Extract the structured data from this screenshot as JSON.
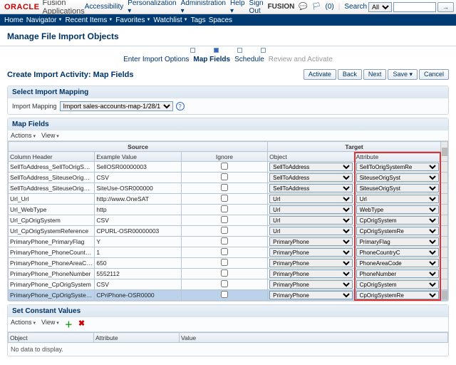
{
  "brand": {
    "oracle": "ORACLE",
    "product": "Fusion Applications"
  },
  "topnav": {
    "accessibility": "Accessibility",
    "personalization": "Personalization ▾",
    "administration": "Administration ▾",
    "help": "Help ▾",
    "signout": "Sign Out",
    "user": "FUSION",
    "flag": "🏳",
    "count": "(0)",
    "searchLabel": "Search",
    "searchScope": "All",
    "go": "→"
  },
  "menurow": {
    "home": "Home",
    "navigator": "Navigator",
    "recent": "Recent Items",
    "favorites": "Favorites",
    "watchlist": "Watchlist",
    "tags": "Tags",
    "spaces": "Spaces"
  },
  "pageTitle": "Manage File Import Objects",
  "wizard": {
    "step1": "Enter Import Options",
    "step2": "Map Fields",
    "step3": "Schedule",
    "step4": "Review and Activate"
  },
  "subtitle": "Create Import Activity: Map Fields",
  "actions": {
    "activate": "Activate",
    "back": "Back",
    "next": "Next",
    "save": "Save ▾",
    "cancel": "Cancel"
  },
  "mapping": {
    "title": "Select Import Mapping",
    "label": "Import Mapping",
    "value": "Import sales-accounts-map-1/28/1"
  },
  "mapfields": {
    "title": "Map Fields",
    "actions": "Actions",
    "view": "View",
    "groupSource": "Source",
    "groupTarget": "Target",
    "colHeader": "Column Header",
    "colExample": "Example Value",
    "colIgnore": "Ignore",
    "colObject": "Object",
    "colAttr": "Attribute",
    "rows": [
      {
        "h": "SellToAddress_SellToOrigSystemReference",
        "ex": "SellOSR00000003",
        "obj": "SellToAddress",
        "attr": "SellToOrigSystemRe"
      },
      {
        "h": "SellToAddress_SiteuseOrigSystem",
        "ex": "CSV",
        "obj": "SellToAddress",
        "attr": "SiteuseOrigSyst"
      },
      {
        "h": "SellToAddress_SiteuseOrigSystemRef",
        "ex": "SiteUse-OSR000000",
        "obj": "SellToAddress",
        "attr": "SiteuseOrigSyst"
      },
      {
        "h": "Url_Url",
        "ex": "http://www.OneSAT",
        "obj": "Url",
        "attr": "Url"
      },
      {
        "h": "Url_WebType",
        "ex": "http",
        "obj": "Url",
        "attr": "WebType"
      },
      {
        "h": "Url_CpOrigSystem",
        "ex": "CSV",
        "obj": "Url",
        "attr": "CpOrigSystem"
      },
      {
        "h": "Url_CpOrigSystemReference",
        "ex": "CPURL-OSR00000003",
        "obj": "Url",
        "attr": "CpOrigSystemRe"
      },
      {
        "h": "PrimaryPhone_PrimaryFlag",
        "ex": "Y",
        "obj": "PrimaryPhone",
        "attr": "PrimaryFlag"
      },
      {
        "h": "PrimaryPhone_PhoneCountryCode",
        "ex": "1",
        "obj": "PrimaryPhone",
        "attr": "PhoneCountryC"
      },
      {
        "h": "PrimaryPhone_PhoneAreaCode",
        "ex": "650",
        "obj": "PrimaryPhone",
        "attr": "PhoneAreaCode"
      },
      {
        "h": "PrimaryPhone_PhoneNumber",
        "ex": "5552112",
        "obj": "PrimaryPhone",
        "attr": "PhoneNumber"
      },
      {
        "h": "PrimaryPhone_CpOrigSystem",
        "ex": "CSV",
        "obj": "PrimaryPhone",
        "attr": "CpOrigSystem"
      },
      {
        "h": "PrimaryPhone_CpOrigSystemReference",
        "ex": "CPriPhone-OSR0000",
        "obj": "PrimaryPhone",
        "attr": "CpOrigSystemRe",
        "selected": true
      }
    ]
  },
  "constants": {
    "title": "Set Constant Values",
    "actions": "Actions",
    "view": "View",
    "colObject": "Object",
    "colAttr": "Attribute",
    "colValue": "Value",
    "nodata": "No data to display."
  }
}
